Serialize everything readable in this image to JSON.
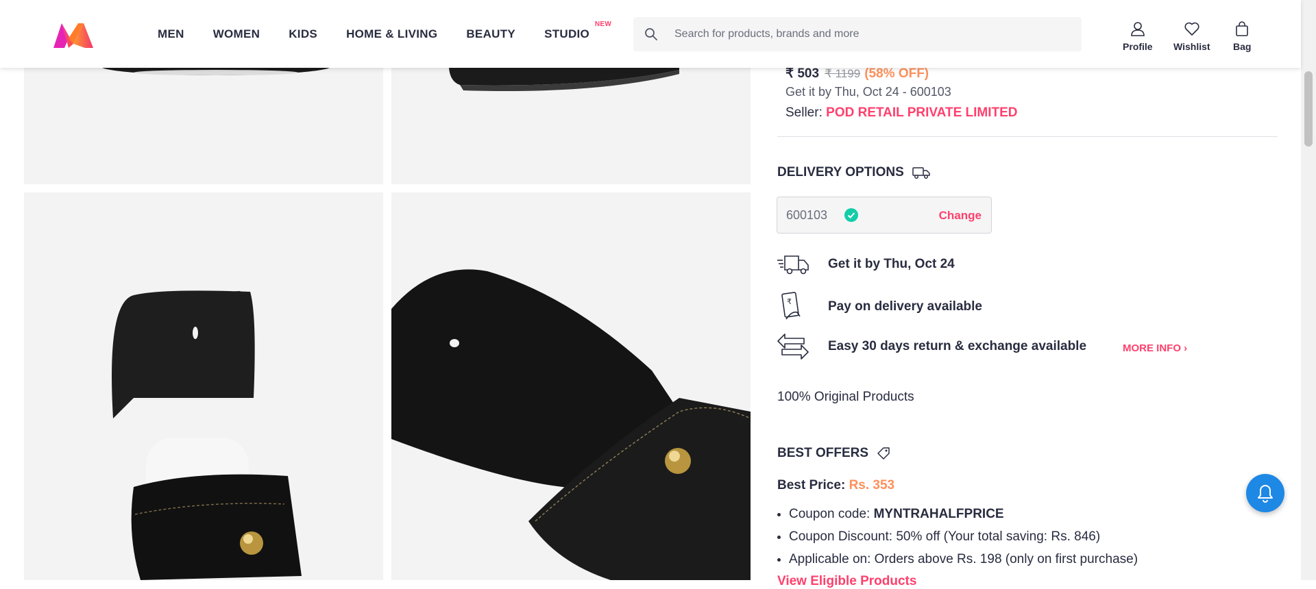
{
  "header": {
    "nav": [
      "MEN",
      "WOMEN",
      "KIDS",
      "HOME & LIVING",
      "BEAUTY",
      "STUDIO"
    ],
    "studio_badge": "NEW",
    "search_placeholder": "Search for products, brands and more",
    "profile": "Profile",
    "wishlist": "Wishlist",
    "bag": "Bag"
  },
  "product": {
    "price": "₹ 503",
    "mrp": "₹ 1199",
    "discount": "(58% OFF)",
    "delivery_estimate": "Get it by Thu, Oct 24 - 600103",
    "seller_label": "Seller: ",
    "seller_name": "POD RETAIL PRIVATE LIMITED"
  },
  "delivery": {
    "title": "DELIVERY OPTIONS",
    "pincode": "600103",
    "change": "Change",
    "options": [
      "Get it by Thu, Oct 24",
      "Pay on delivery available",
      "Easy 30 days return & exchange available"
    ],
    "more_info": "MORE INFO",
    "original": "100% Original Products"
  },
  "offers": {
    "title": "BEST OFFERS",
    "best_price_label": "Best Price:",
    "best_price_value": "Rs. 353",
    "coupon_code_label": "Coupon code: ",
    "coupon_code": "MYNTRAHALFPRICE",
    "coupon_discount": "Coupon Discount: 50% off (Your total saving: Rs. 846)",
    "applicable": "Applicable on: Orders above Rs. 198 (only on first purchase)",
    "view_eligible": "View Eligible Products"
  },
  "colors": {
    "brand_pink": "#ff3f6c",
    "discount_orange": "#ff905a",
    "text_dark": "#282c3f",
    "bell_blue": "#1e88e5"
  }
}
